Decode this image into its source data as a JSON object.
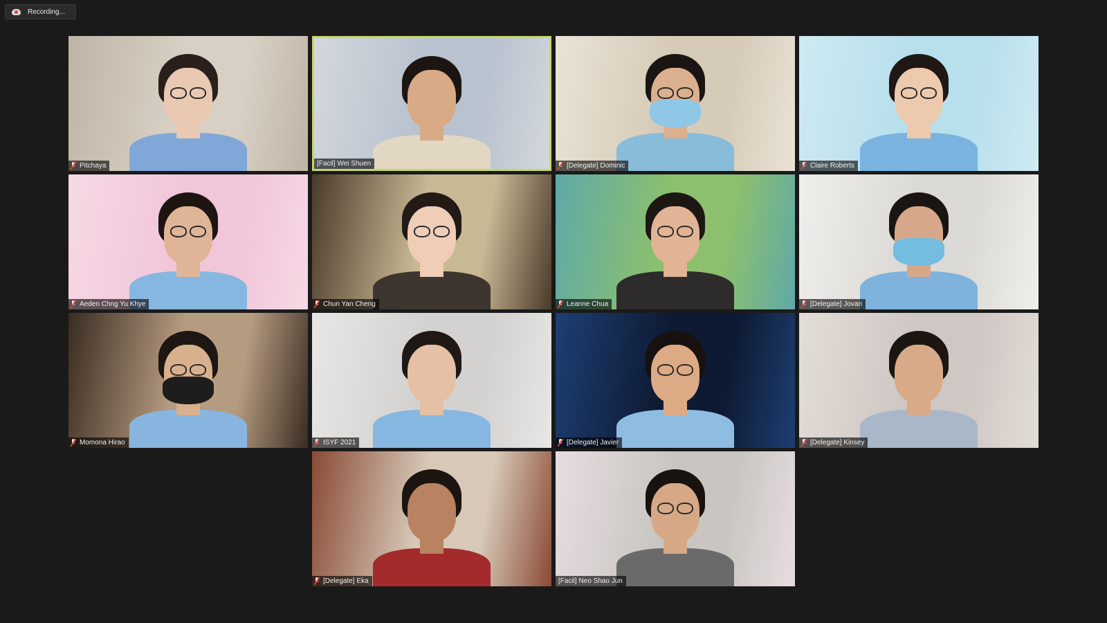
{
  "recording": {
    "label": "Recording...",
    "icon": "cloud-record-icon",
    "dot_color": "#e0413a"
  },
  "meeting": {
    "active_speaker_border_color": "#c4d86a",
    "participants": [
      {
        "name": "Pitchaya",
        "muted": true,
        "active": false,
        "bg": "#d8d0c4",
        "wall2": "#bfb4a6",
        "skin": "#e9c9b2",
        "hair": "#2b1f1c",
        "shirt": "#7fa8d8",
        "glasses": true,
        "mask": null
      },
      {
        "name": "[Facil] Wei Shuen",
        "muted": false,
        "active": true,
        "bg": "#b9c2cf",
        "wall2": "#d4d8dd",
        "skin": "#d8aa86",
        "hair": "#1c1613",
        "shirt": "#e2d7c3",
        "glasses": false,
        "mask": null
      },
      {
        "name": "[Delegate] Dominic",
        "muted": true,
        "active": false,
        "bg": "#d6cbb8",
        "wall2": "#eae3d6",
        "skin": "#dab08f",
        "hair": "#1a1512",
        "shirt": "#89bcd8",
        "glasses": true,
        "mask": "#8fc7e6"
      },
      {
        "name": "Claire Roberts",
        "muted": true,
        "active": false,
        "bg": "#b7dfec",
        "wall2": "#cfeaf3",
        "skin": "#edc9ad",
        "hair": "#1f1814",
        "shirt": "#7ab3df",
        "glasses": true,
        "mask": null
      },
      {
        "name": "Aeden Chng Yu Khye",
        "muted": true,
        "active": false,
        "bg": "#f1c6d9",
        "wall2": "#f7d9e5",
        "skin": "#e0b496",
        "hair": "#1c1512",
        "shirt": "#86b7e0",
        "glasses": true,
        "mask": null
      },
      {
        "name": "Chun Yan Cheng",
        "muted": true,
        "active": false,
        "bg": "#c9b894",
        "wall2": "#4a3a2a",
        "skin": "#f0cdb7",
        "hair": "#231a16",
        "shirt": "#3d3530",
        "glasses": true,
        "mask": null
      },
      {
        "name": "Leanne Chua",
        "muted": true,
        "active": false,
        "bg": "#8cc06e",
        "wall2": "#5fa9a8",
        "skin": "#e0b495",
        "hair": "#1d1714",
        "shirt": "#2d2b2c",
        "glasses": true,
        "mask": null
      },
      {
        "name": "[Delegate] Jovan",
        "muted": true,
        "active": false,
        "bg": "#dcdad6",
        "wall2": "#f0efec",
        "skin": "#d6a889",
        "hair": "#1a1512",
        "shirt": "#7fb2dc",
        "glasses": false,
        "mask": "#72bde0"
      },
      {
        "name": "Momona Hirao",
        "muted": true,
        "active": false,
        "bg": "#b59b80",
        "wall2": "#3a2c22",
        "skin": "#d9b08d",
        "hair": "#1d1613",
        "shirt": "#88b5e0",
        "glasses": true,
        "mask": "#1d1d1d"
      },
      {
        "name": "ISYF 2021",
        "muted": true,
        "active": false,
        "bg": "#d3d2d0",
        "wall2": "#e8e7e4",
        "skin": "#e6c0a4",
        "hair": "#1f1814",
        "shirt": "#86b7e0",
        "glasses": false,
        "mask": null
      },
      {
        "name": "[Delegate] Javier",
        "muted": true,
        "active": false,
        "bg": "#0e1a33",
        "wall2": "#1d3f74",
        "skin": "#dcaa85",
        "hair": "#17120f",
        "shirt": "#8fbde2",
        "glasses": true,
        "mask": null
      },
      {
        "name": "[Delegate] Kinsey",
        "muted": true,
        "active": false,
        "bg": "#cfc7c3",
        "wall2": "#e3ddd8",
        "skin": "#d8aa88",
        "hair": "#1c1613",
        "shirt": "#a9b7c9",
        "glasses": false,
        "mask": null
      },
      {
        "name": "[Delegate] Eka",
        "muted": true,
        "active": false,
        "bg": "#d7c8b8",
        "wall2": "#8a4a35",
        "skin": "#b98260",
        "hair": "#1b1410",
        "shirt": "#a32b2b",
        "glasses": false,
        "mask": null
      },
      {
        "name": "[Facil] Neo Shao Jun",
        "muted": false,
        "active": false,
        "bg": "#c9c6c1",
        "wall2": "#e7dde0",
        "skin": "#d6a886",
        "hair": "#18130f",
        "shirt": "#6a6a6a",
        "glasses": true,
        "mask": null
      }
    ]
  }
}
